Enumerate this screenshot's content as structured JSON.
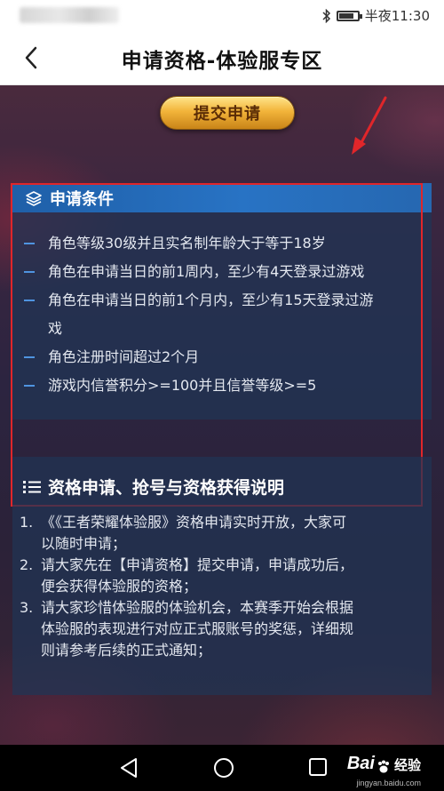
{
  "status_bar": {
    "time": "半夜11:30",
    "icons": [
      "bluetooth-icon",
      "battery-icon"
    ]
  },
  "header": {
    "title": "申请资格-体验服专区",
    "back_icon": "chevron-left-icon"
  },
  "submit_button": {
    "label": "提交申请"
  },
  "conditions": {
    "title": "申请条件",
    "icon": "layers-icon",
    "items": [
      "角色等级30级并且实名制年龄大于等于18岁",
      "角色在申请当日的前1周内，至少有4天登录过游戏",
      "角色在申请当日的前1个月内，至少有15天登录过游",
      "戏",
      "角色注册时间超过2个月",
      "游戏内信誉积分>=100并且信誉等级>=5"
    ]
  },
  "info": {
    "title": "资格申请、抢号与资格获得说明",
    "icon": "list-icon",
    "items": [
      {
        "num": "1.",
        "lines": [
          "《《王者荣耀体验服》资格申请实时开放，大家可",
          "以随时申请；"
        ]
      },
      {
        "num": "2.",
        "lines": [
          "请大家先在【申请资格】提交申请，申请成功后，",
          "便会获得体验服的资格；"
        ]
      },
      {
        "num": "3.",
        "lines": [
          "请大家珍惜体验服的体验机会，本赛季开始会根据",
          "体验服的表现进行对应正式服账号的奖惩，详细规",
          "则请参考后续的正式通知；"
        ]
      }
    ]
  },
  "watermark": {
    "logo": "Bai",
    "text": "经验",
    "sub": "jingyan.baidu.com"
  },
  "colors": {
    "accent_blue": "#2873c4",
    "annotation_red": "#e0262a",
    "button_gold": "#f2b43a"
  }
}
